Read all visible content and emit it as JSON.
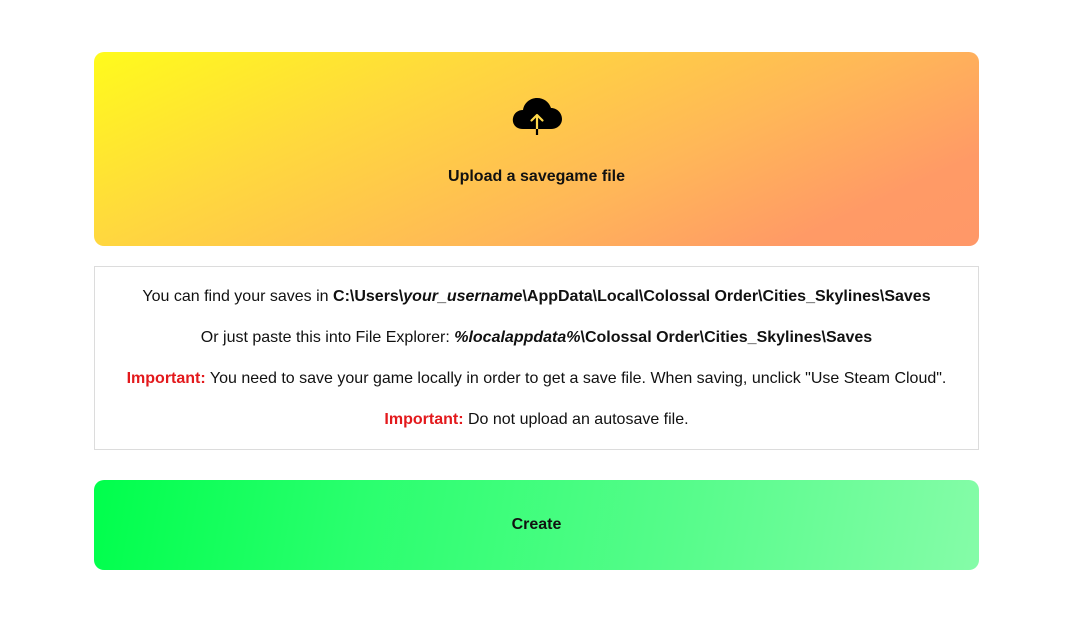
{
  "upload": {
    "label": "Upload a savegame file",
    "icon": "cloud-upload-icon"
  },
  "info": {
    "line1_prefix": "You can find your saves in ",
    "line1_path_a": "C:\\Users\\",
    "line1_path_user": "your_username",
    "line1_path_b": "\\AppData\\Local\\Colossal Order\\Cities_Skylines\\Saves",
    "line2_prefix": "Or just paste this into File Explorer: ",
    "line2_path_var": "%localappdata%",
    "line2_path_b": "\\Colossal Order\\Cities_Skylines\\Saves",
    "important_label": "Important:",
    "line3_text": " You need to save your game locally in order to get a save file. When saving, unclick \"Use Steam Cloud\".",
    "line4_text": " Do not upload an autosave file."
  },
  "create": {
    "label": "Create"
  },
  "colors": {
    "important": "#e3191c",
    "upload_gradient": [
      "#fffb1c",
      "#ff9868"
    ],
    "create_gradient": [
      "#00ff4c",
      "#85fca8"
    ]
  }
}
